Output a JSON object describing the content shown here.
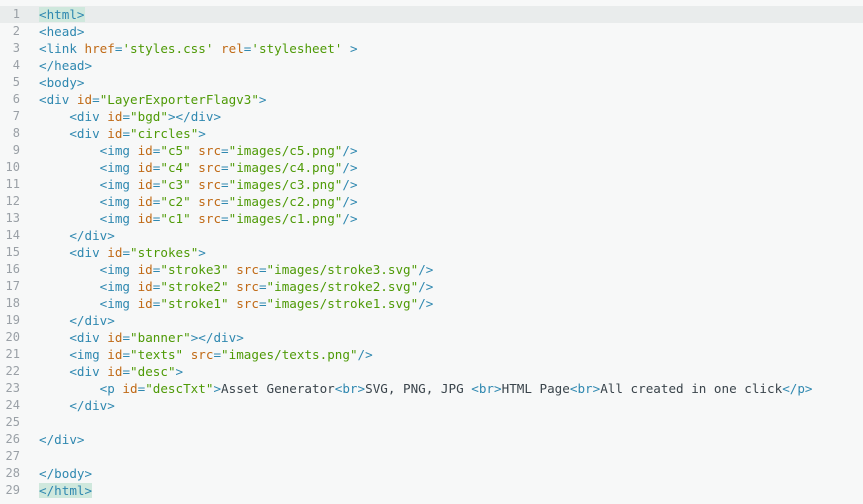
{
  "editor": {
    "language": "html",
    "active_line": 1,
    "colors": {
      "background": "#f7f8f8",
      "active_line": "#e9ecec",
      "tag": "#2f88b0",
      "attribute": "#c06a16",
      "string": "#4e9a06",
      "text": "#3a444b",
      "line_number": "#9aa0a6",
      "bracket_match": "#cfe8dd"
    },
    "lines": [
      {
        "num": "1",
        "tokens": [
          [
            "hl",
            "<html>"
          ]
        ]
      },
      {
        "num": "2",
        "tokens": [
          [
            "tag",
            "<head>"
          ]
        ]
      },
      {
        "num": "3",
        "tokens": [
          [
            "tag",
            "<link "
          ],
          [
            "attr",
            "href"
          ],
          [
            "tag",
            "="
          ],
          [
            "str",
            "'styles.css'"
          ],
          [
            "tag",
            " "
          ],
          [
            "attr",
            "rel"
          ],
          [
            "tag",
            "="
          ],
          [
            "str",
            "'stylesheet'"
          ],
          [
            "tag",
            " >"
          ]
        ]
      },
      {
        "num": "4",
        "tokens": [
          [
            "tag",
            "</head>"
          ]
        ]
      },
      {
        "num": "5",
        "tokens": [
          [
            "tag",
            "<body>"
          ]
        ]
      },
      {
        "num": "6",
        "tokens": [
          [
            "tag",
            "<div "
          ],
          [
            "attr",
            "id"
          ],
          [
            "tag",
            "="
          ],
          [
            "str",
            "\"LayerExporterFlagv3\""
          ],
          [
            "tag",
            ">"
          ]
        ]
      },
      {
        "num": "7",
        "tokens": [
          [
            "txt",
            "    "
          ],
          [
            "tag",
            "<div "
          ],
          [
            "attr",
            "id"
          ],
          [
            "tag",
            "="
          ],
          [
            "str",
            "\"bgd\""
          ],
          [
            "tag",
            "></div>"
          ]
        ]
      },
      {
        "num": "8",
        "tokens": [
          [
            "txt",
            "    "
          ],
          [
            "tag",
            "<div "
          ],
          [
            "attr",
            "id"
          ],
          [
            "tag",
            "="
          ],
          [
            "str",
            "\"circles\""
          ],
          [
            "tag",
            ">"
          ]
        ]
      },
      {
        "num": "9",
        "tokens": [
          [
            "txt",
            "        "
          ],
          [
            "tag",
            "<img "
          ],
          [
            "attr",
            "id"
          ],
          [
            "tag",
            "="
          ],
          [
            "str",
            "\"c5\""
          ],
          [
            "tag",
            " "
          ],
          [
            "attr",
            "src"
          ],
          [
            "tag",
            "="
          ],
          [
            "str",
            "\"images/c5.png\""
          ],
          [
            "tag",
            "/>"
          ]
        ]
      },
      {
        "num": "10",
        "tokens": [
          [
            "txt",
            "        "
          ],
          [
            "tag",
            "<img "
          ],
          [
            "attr",
            "id"
          ],
          [
            "tag",
            "="
          ],
          [
            "str",
            "\"c4\""
          ],
          [
            "tag",
            " "
          ],
          [
            "attr",
            "src"
          ],
          [
            "tag",
            "="
          ],
          [
            "str",
            "\"images/c4.png\""
          ],
          [
            "tag",
            "/>"
          ]
        ]
      },
      {
        "num": "11",
        "tokens": [
          [
            "txt",
            "        "
          ],
          [
            "tag",
            "<img "
          ],
          [
            "attr",
            "id"
          ],
          [
            "tag",
            "="
          ],
          [
            "str",
            "\"c3\""
          ],
          [
            "tag",
            " "
          ],
          [
            "attr",
            "src"
          ],
          [
            "tag",
            "="
          ],
          [
            "str",
            "\"images/c3.png\""
          ],
          [
            "tag",
            "/>"
          ]
        ]
      },
      {
        "num": "12",
        "tokens": [
          [
            "txt",
            "        "
          ],
          [
            "tag",
            "<img "
          ],
          [
            "attr",
            "id"
          ],
          [
            "tag",
            "="
          ],
          [
            "str",
            "\"c2\""
          ],
          [
            "tag",
            " "
          ],
          [
            "attr",
            "src"
          ],
          [
            "tag",
            "="
          ],
          [
            "str",
            "\"images/c2.png\""
          ],
          [
            "tag",
            "/>"
          ]
        ]
      },
      {
        "num": "13",
        "tokens": [
          [
            "txt",
            "        "
          ],
          [
            "tag",
            "<img "
          ],
          [
            "attr",
            "id"
          ],
          [
            "tag",
            "="
          ],
          [
            "str",
            "\"c1\""
          ],
          [
            "tag",
            " "
          ],
          [
            "attr",
            "src"
          ],
          [
            "tag",
            "="
          ],
          [
            "str",
            "\"images/c1.png\""
          ],
          [
            "tag",
            "/>"
          ]
        ]
      },
      {
        "num": "14",
        "tokens": [
          [
            "txt",
            "    "
          ],
          [
            "tag",
            "</div>"
          ]
        ]
      },
      {
        "num": "15",
        "tokens": [
          [
            "txt",
            "    "
          ],
          [
            "tag",
            "<div "
          ],
          [
            "attr",
            "id"
          ],
          [
            "tag",
            "="
          ],
          [
            "str",
            "\"strokes\""
          ],
          [
            "tag",
            ">"
          ]
        ]
      },
      {
        "num": "16",
        "tokens": [
          [
            "txt",
            "        "
          ],
          [
            "tag",
            "<img "
          ],
          [
            "attr",
            "id"
          ],
          [
            "tag",
            "="
          ],
          [
            "str",
            "\"stroke3\""
          ],
          [
            "tag",
            " "
          ],
          [
            "attr",
            "src"
          ],
          [
            "tag",
            "="
          ],
          [
            "str",
            "\"images/stroke3.svg\""
          ],
          [
            "tag",
            "/>"
          ]
        ]
      },
      {
        "num": "17",
        "tokens": [
          [
            "txt",
            "        "
          ],
          [
            "tag",
            "<img "
          ],
          [
            "attr",
            "id"
          ],
          [
            "tag",
            "="
          ],
          [
            "str",
            "\"stroke2\""
          ],
          [
            "tag",
            " "
          ],
          [
            "attr",
            "src"
          ],
          [
            "tag",
            "="
          ],
          [
            "str",
            "\"images/stroke2.svg\""
          ],
          [
            "tag",
            "/>"
          ]
        ]
      },
      {
        "num": "18",
        "tokens": [
          [
            "txt",
            "        "
          ],
          [
            "tag",
            "<img "
          ],
          [
            "attr",
            "id"
          ],
          [
            "tag",
            "="
          ],
          [
            "str",
            "\"stroke1\""
          ],
          [
            "tag",
            " "
          ],
          [
            "attr",
            "src"
          ],
          [
            "tag",
            "="
          ],
          [
            "str",
            "\"images/stroke1.svg\""
          ],
          [
            "tag",
            "/>"
          ]
        ]
      },
      {
        "num": "19",
        "tokens": [
          [
            "txt",
            "    "
          ],
          [
            "tag",
            "</div>"
          ]
        ]
      },
      {
        "num": "20",
        "tokens": [
          [
            "txt",
            "    "
          ],
          [
            "tag",
            "<div "
          ],
          [
            "attr",
            "id"
          ],
          [
            "tag",
            "="
          ],
          [
            "str",
            "\"banner\""
          ],
          [
            "tag",
            "></div>"
          ]
        ]
      },
      {
        "num": "21",
        "tokens": [
          [
            "txt",
            "    "
          ],
          [
            "tag",
            "<img "
          ],
          [
            "attr",
            "id"
          ],
          [
            "tag",
            "="
          ],
          [
            "str",
            "\"texts\""
          ],
          [
            "tag",
            " "
          ],
          [
            "attr",
            "src"
          ],
          [
            "tag",
            "="
          ],
          [
            "str",
            "\"images/texts.png\""
          ],
          [
            "tag",
            "/>"
          ]
        ]
      },
      {
        "num": "22",
        "tokens": [
          [
            "txt",
            "    "
          ],
          [
            "tag",
            "<div "
          ],
          [
            "attr",
            "id"
          ],
          [
            "tag",
            "="
          ],
          [
            "str",
            "\"desc\""
          ],
          [
            "tag",
            ">"
          ]
        ]
      },
      {
        "num": "23",
        "tokens": [
          [
            "txt",
            "        "
          ],
          [
            "tag",
            "<p "
          ],
          [
            "attr",
            "id"
          ],
          [
            "tag",
            "="
          ],
          [
            "str",
            "\"descTxt\""
          ],
          [
            "tag",
            ">"
          ],
          [
            "txt",
            "Asset Generator"
          ],
          [
            "tag",
            "<br>"
          ],
          [
            "txt",
            "SVG, PNG, JPG "
          ],
          [
            "tag",
            "<br>"
          ],
          [
            "txt",
            "HTML Page"
          ],
          [
            "tag",
            "<br>"
          ],
          [
            "txt",
            "All created in one click"
          ],
          [
            "tag",
            "</p>"
          ]
        ]
      },
      {
        "num": "24",
        "tokens": [
          [
            "txt",
            "    "
          ],
          [
            "tag",
            "</div>"
          ]
        ]
      },
      {
        "num": "25",
        "tokens": []
      },
      {
        "num": "26",
        "tokens": [
          [
            "tag",
            "</div>"
          ]
        ]
      },
      {
        "num": "27",
        "tokens": []
      },
      {
        "num": "28",
        "tokens": [
          [
            "tag",
            "</body>"
          ]
        ]
      },
      {
        "num": "29",
        "tokens": [
          [
            "hl",
            "</html>"
          ]
        ]
      }
    ]
  }
}
